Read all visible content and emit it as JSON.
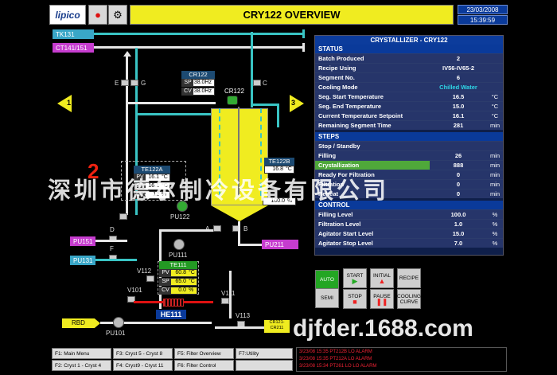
{
  "header": {
    "logo": "lipico",
    "title": "CRY122 OVERVIEW",
    "date": "23/03/2008",
    "time": "15:39:59",
    "alarm_icon": "alarm-bell-icon",
    "settings_icon": "tools-icon"
  },
  "tags": {
    "tk131": "TK131",
    "ct141": "CT141/151",
    "pu151": "PU151",
    "pu131": "PU131",
    "pu211": "PU211",
    "rbd": "RBD",
    "pu101": "PU101",
    "pu111": "PU111",
    "pu122": "PU122",
    "he111": "HE111",
    "cr121": "CR121-\nCR211"
  },
  "process": {
    "nav_left": "1",
    "nav_right": "3",
    "cr122_box": {
      "title": "CR122",
      "sp": "38.0Hz",
      "cv": "38.0Hz",
      "sp_label": "SP",
      "cv_label": "CV"
    },
    "cr122_label": "CR122",
    "hh_label": "HH",
    "te122b": {
      "title": "TE122B",
      "value": "16.8",
      "unit": "°C"
    },
    "lt_value": "100.0",
    "lt_unit": "%",
    "te122a": {
      "title": "TE122A",
      "pv": "16.1",
      "sp": "16.1",
      "cv": "12",
      "pv_unit": "°C",
      "sp_unit": "°C",
      "cv_unit": "%",
      "pv_label": "PV",
      "sp_label": "SP",
      "cv_label": "CV"
    },
    "te111": {
      "title": "TE111",
      "pv": "60.8",
      "sp": "65.0",
      "cv": "0.0",
      "pv_unit": "°C",
      "sp_unit": "°C",
      "cv_unit": "%",
      "pv_label": "PV",
      "sp_label": "SP",
      "cv_label": "CV"
    },
    "valves": {
      "e": "E",
      "g": "G",
      "c": "C",
      "a": "A",
      "b": "B",
      "d": "D",
      "f": "F",
      "v112": "V112",
      "v101": "V101",
      "v111": "V111",
      "v113": "V113"
    },
    "red_number": "2"
  },
  "panel": {
    "title": "CRYSTALLIZER - CRY122",
    "status_header": "STATUS",
    "status": [
      {
        "label": "Batch Produced",
        "value": "2",
        "unit": ""
      },
      {
        "label": "Recipe Using",
        "value": "IV56-IV65-2",
        "unit": ""
      },
      {
        "label": "Segment No.",
        "value": "6",
        "unit": ""
      },
      {
        "label": "Cooling Mode",
        "value": "Chilled Water",
        "unit": ""
      },
      {
        "label": "Seg. Start Temperature",
        "value": "16.5",
        "unit": "°C"
      },
      {
        "label": "Seg. End Temperature",
        "value": "15.0",
        "unit": "°C"
      },
      {
        "label": "Current Temperature Setpoint",
        "value": "16.1",
        "unit": "°C"
      },
      {
        "label": "Remaining Segment Time",
        "value": "281",
        "unit": "min"
      }
    ],
    "steps_header": "STEPS",
    "steps": [
      {
        "label": "Stop / Standby",
        "value": "",
        "unit": ""
      },
      {
        "label": "Filling",
        "value": "26",
        "unit": "min"
      },
      {
        "label": "Crystallization",
        "value": "888",
        "unit": "min"
      },
      {
        "label": "Ready For Filtration",
        "value": "0",
        "unit": "min"
      },
      {
        "label": "Filtration",
        "value": "0",
        "unit": "min"
      },
      {
        "label": "Reheat",
        "value": "0",
        "unit": "min"
      }
    ],
    "control_header": "CONTROL",
    "control": [
      {
        "label": "Filling Level",
        "value": "100.0",
        "unit": "%"
      },
      {
        "label": "Filtration Level",
        "value": "1.0",
        "unit": "%"
      },
      {
        "label": "Agitator Start Level",
        "value": "15.0",
        "unit": "%"
      },
      {
        "label": "Agitator Stop Level",
        "value": "7.0",
        "unit": "%"
      }
    ]
  },
  "buttons": {
    "auto": "AUTO",
    "semi": "SEMI",
    "start": "START",
    "initial": "INITIAL",
    "recipe": "RECIPE",
    "stop": "STOP",
    "pause": "PAUSE",
    "cooling_curve": "COOLING CURVE"
  },
  "fkeys": [
    "F1: Main Menu",
    "F2: Cryst 1 - Cryst 4",
    "F3: Cryst 5 - Cryst 8",
    "F4: Cryst9 - Cryst 11",
    "F5: Filter Overview",
    "F6: Filter Control",
    "F7:Utility"
  ],
  "alarms": [
    "3/23/08 15:35  PT212B LO ALARM",
    "3/23/08 15:35  PT212A LO ALARM",
    "3/23/08 15:34  PT261 LO LO ALARM"
  ],
  "watermark": {
    "cn": "深圳市德尔制冷设备有限公司",
    "url": "djfder.1688.com"
  }
}
